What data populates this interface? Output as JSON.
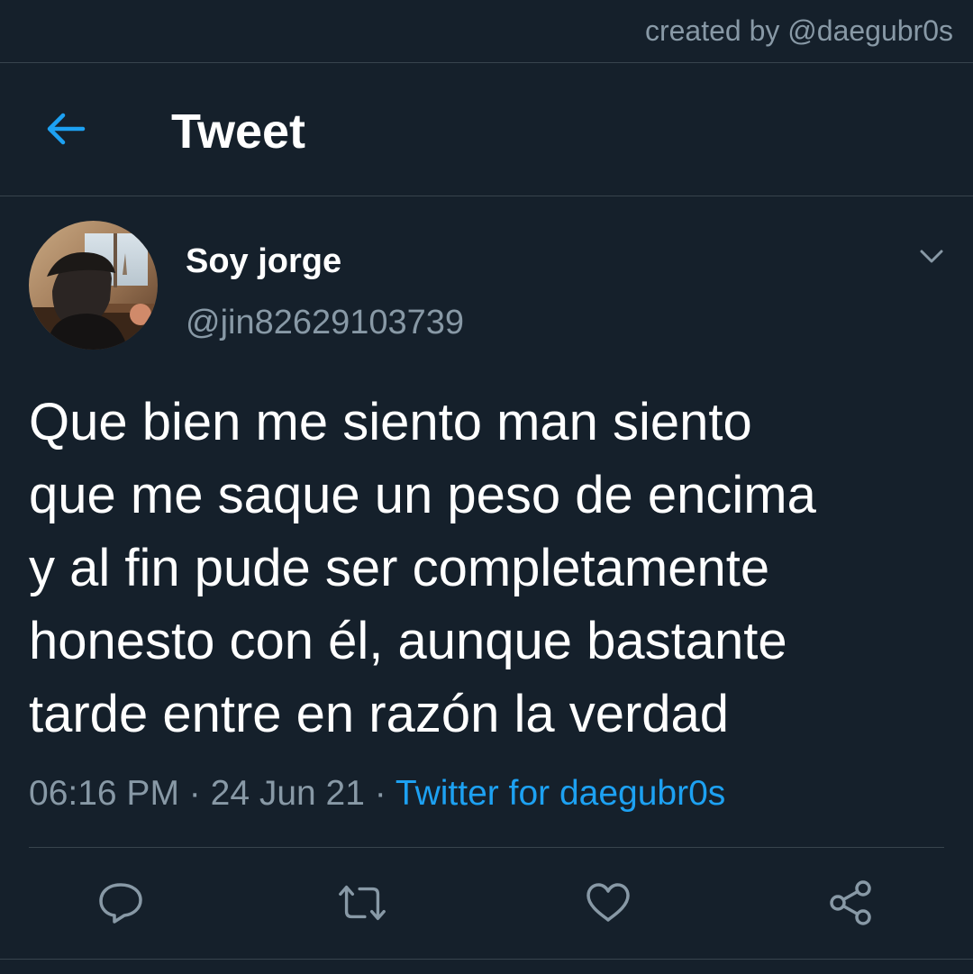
{
  "watermark": "created by @daegubr0s",
  "header": {
    "title": "Tweet",
    "back_icon": "arrow-left-icon",
    "back_icon_color": "#1da1f2"
  },
  "tweet": {
    "display_name": "Soy jorge",
    "handle": "@jin82629103739",
    "menu_icon": "chevron-down-icon",
    "text": "Que bien me siento man siento\nque me saque un peso de encima\ny al fin pude ser completamente\nhonesto con él, aunque bastante\ntarde entre en razón la verdad",
    "time": "06:16 PM",
    "separator": "·",
    "date": "24 Jun 21",
    "source": "Twitter for daegubr0s"
  },
  "actions": [
    {
      "icon": "reply-icon"
    },
    {
      "icon": "retweet-icon"
    },
    {
      "icon": "like-icon"
    },
    {
      "icon": "share-icon"
    }
  ],
  "colors": {
    "background": "#15202b",
    "divider": "#38444d",
    "secondary_text": "#8899a6",
    "accent": "#1da1f2",
    "primary_text": "#ffffff"
  }
}
